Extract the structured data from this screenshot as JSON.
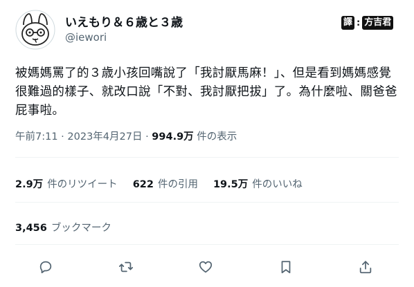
{
  "tweet": {
    "display_name": "いえもり＆６歳と３歳",
    "handle": "@iewori",
    "watermark": {
      "left": "譯",
      "right": "方吉君"
    },
    "text": "被媽媽罵了的３歳小孩回嘴說了「我討厭馬麻！」、但是看到媽媽感覺很難過的樣子、就改口說「不對、我討厭把拔」了。為什麼啦、關爸爸屁事啦。",
    "time": "午前7:11",
    "date": "2023年4月27日",
    "views_count": "994.9万",
    "views_label": "件の表示",
    "retweets_count": "2.9万",
    "retweets_label": "件のリツイート",
    "quotes_count": "622",
    "quotes_label": "件の引用",
    "likes_count": "19.5万",
    "likes_label": "件のいいね",
    "bookmarks_count": "3,456",
    "bookmarks_label": "ブックマーク"
  },
  "icons": [
    "reply-icon",
    "retweet-icon",
    "like-icon",
    "bookmark-icon",
    "share-icon"
  ]
}
